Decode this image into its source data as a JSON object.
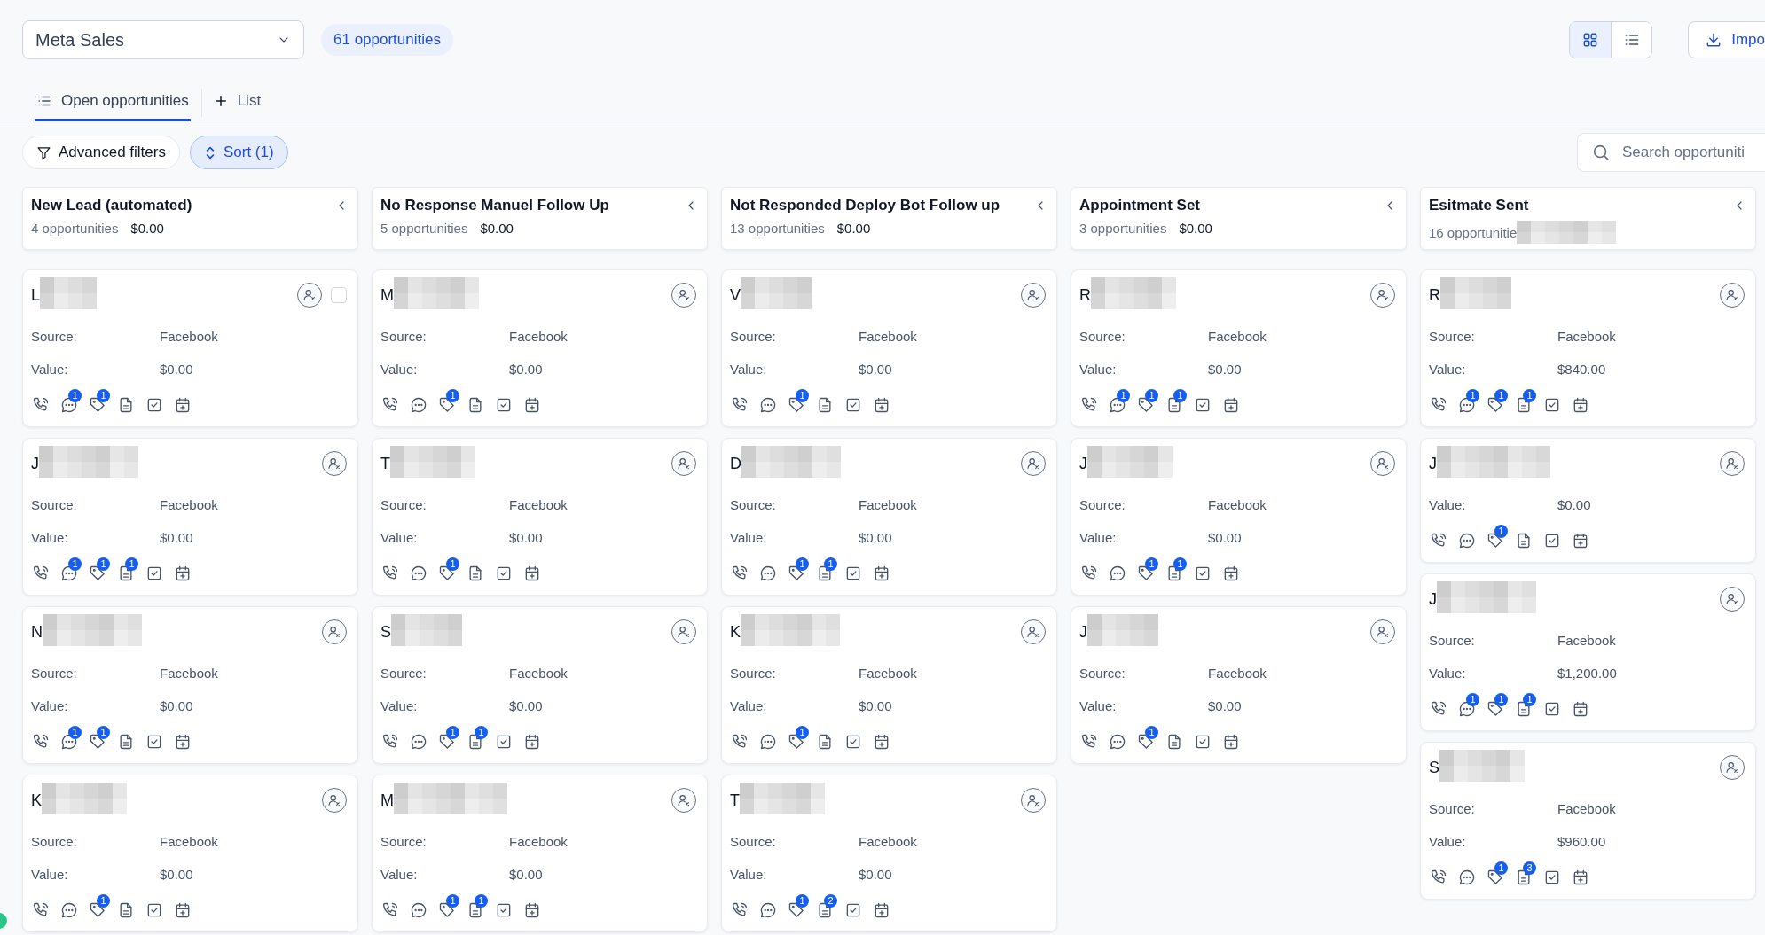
{
  "pipeline": {
    "name": "Meta Sales"
  },
  "count_badge": "61 opportunities",
  "view_toggle": [
    {
      "kind": "grid",
      "selected": true
    },
    {
      "kind": "list",
      "selected": false
    }
  ],
  "import_button": "Impo",
  "tabs": [
    {
      "kind": "list",
      "label": "Open opportunities",
      "selected": true
    },
    {
      "kind": "add",
      "label": "List",
      "selected": false
    }
  ],
  "filters": {
    "advanced": "Advanced filters",
    "sort": "Sort (1)"
  },
  "search": {
    "placeholder": "Search opportuniti"
  },
  "columns": [
    {
      "title": "New Lead (automated)",
      "count": "4 opportunities",
      "amount": "$0.00",
      "cards": [
        {
          "name": "L",
          "checked": false,
          "fields": [
            {
              "label": "Source:",
              "value": "Facebook"
            },
            {
              "label": "Value:",
              "value": "$0.00"
            }
          ],
          "counts": {
            "chat": "1",
            "tag": "1"
          }
        },
        {
          "name": "J",
          "fields": [
            {
              "label": "Source:",
              "value": "Facebook"
            },
            {
              "label": "Value:",
              "value": "$0.00"
            }
          ],
          "counts": {
            "chat": "1",
            "tag": "1",
            "note": "1"
          }
        },
        {
          "name": "N",
          "fields": [
            {
              "label": "Source:",
              "value": "Facebook"
            },
            {
              "label": "Value:",
              "value": "$0.00"
            }
          ],
          "counts": {
            "chat": "1",
            "tag": "1"
          }
        },
        {
          "name": "K",
          "fields": [
            {
              "label": "Source:",
              "value": "Facebook"
            },
            {
              "label": "Value:",
              "value": "$0.00"
            }
          ],
          "counts": {
            "tag": "1"
          }
        }
      ]
    },
    {
      "title": "No Response Manuel Follow Up",
      "count": "5 opportunities",
      "amount": "$0.00",
      "cards": [
        {
          "name": "M",
          "fields": [
            {
              "label": "Source:",
              "value": "Facebook"
            },
            {
              "label": "Value:",
              "value": "$0.00"
            }
          ],
          "counts": {
            "tag": "1"
          }
        },
        {
          "name": "T",
          "fields": [
            {
              "label": "Source:",
              "value": "Facebook"
            },
            {
              "label": "Value:",
              "value": "$0.00"
            }
          ],
          "counts": {
            "tag": "1"
          }
        },
        {
          "name": "S",
          "fields": [
            {
              "label": "Source:",
              "value": "Facebook"
            },
            {
              "label": "Value:",
              "value": "$0.00"
            }
          ],
          "counts": {
            "tag": "1",
            "note": "1"
          }
        },
        {
          "name": "M",
          "fields": [
            {
              "label": "Source:",
              "value": "Facebook"
            },
            {
              "label": "Value:",
              "value": "$0.00"
            }
          ],
          "counts": {
            "tag": "1",
            "note": "1"
          }
        }
      ]
    },
    {
      "title": "Not Responded Deploy Bot Follow up",
      "count": "13 opportunities",
      "amount": "$0.00",
      "cards": [
        {
          "name": "V",
          "fields": [
            {
              "label": "Source:",
              "value": "Facebook"
            },
            {
              "label": "Value:",
              "value": "$0.00"
            }
          ],
          "counts": {
            "tag": "1"
          }
        },
        {
          "name": "D",
          "fields": [
            {
              "label": "Source:",
              "value": "Facebook"
            },
            {
              "label": "Value:",
              "value": "$0.00"
            }
          ],
          "counts": {
            "tag": "1",
            "note": "1"
          }
        },
        {
          "name": "K",
          "fields": [
            {
              "label": "Source:",
              "value": "Facebook"
            },
            {
              "label": "Value:",
              "value": "$0.00"
            }
          ],
          "counts": {
            "tag": "1"
          }
        },
        {
          "name": "T",
          "fields": [
            {
              "label": "Source:",
              "value": "Facebook"
            },
            {
              "label": "Value:",
              "value": "$0.00"
            }
          ],
          "counts": {
            "tag": "1",
            "note": "2"
          }
        }
      ]
    },
    {
      "title": "Appointment Set",
      "count": "3 opportunities",
      "amount": "$0.00",
      "cards": [
        {
          "name": "R",
          "fields": [
            {
              "label": "Source:",
              "value": "Facebook"
            },
            {
              "label": "Value:",
              "value": "$0.00"
            }
          ],
          "counts": {
            "chat": "1",
            "tag": "1",
            "note": "1"
          }
        },
        {
          "name": "J",
          "fields": [
            {
              "label": "Source:",
              "value": "Facebook"
            },
            {
              "label": "Value:",
              "value": "$0.00"
            }
          ],
          "counts": {
            "tag": "1",
            "note": "1"
          }
        },
        {
          "name": "J",
          "fields": [
            {
              "label": "Source:",
              "value": "Facebook"
            },
            {
              "label": "Value:",
              "value": "$0.00"
            }
          ],
          "counts": {
            "tag": "1"
          }
        }
      ]
    },
    {
      "title": "Esitmate Sent",
      "count": "16 opportunitie",
      "amount_redacted": true,
      "cards": [
        {
          "name": "R",
          "fields": [
            {
              "label": "Source:",
              "value": "Facebook"
            },
            {
              "label": "Value:",
              "value": "$840.00"
            }
          ],
          "counts": {
            "chat": "1",
            "tag": "1",
            "note": "1"
          }
        },
        {
          "name": "J",
          "fields": [
            {
              "label": "Value:",
              "value": "$0.00"
            }
          ],
          "counts": {
            "tag": "1"
          }
        },
        {
          "name": "J",
          "fields": [
            {
              "label": "Source:",
              "value": "Facebook"
            },
            {
              "label": "Value:",
              "value": "$1,200.00"
            }
          ],
          "counts": {
            "chat": "1",
            "tag": "1",
            "note": "1"
          }
        },
        {
          "name": "S",
          "fields": [
            {
              "label": "Source:",
              "value": "Facebook"
            },
            {
              "label": "Value:",
              "value": "$960.00"
            }
          ],
          "counts": {
            "tag": "1",
            "note": "3"
          }
        }
      ]
    }
  ]
}
